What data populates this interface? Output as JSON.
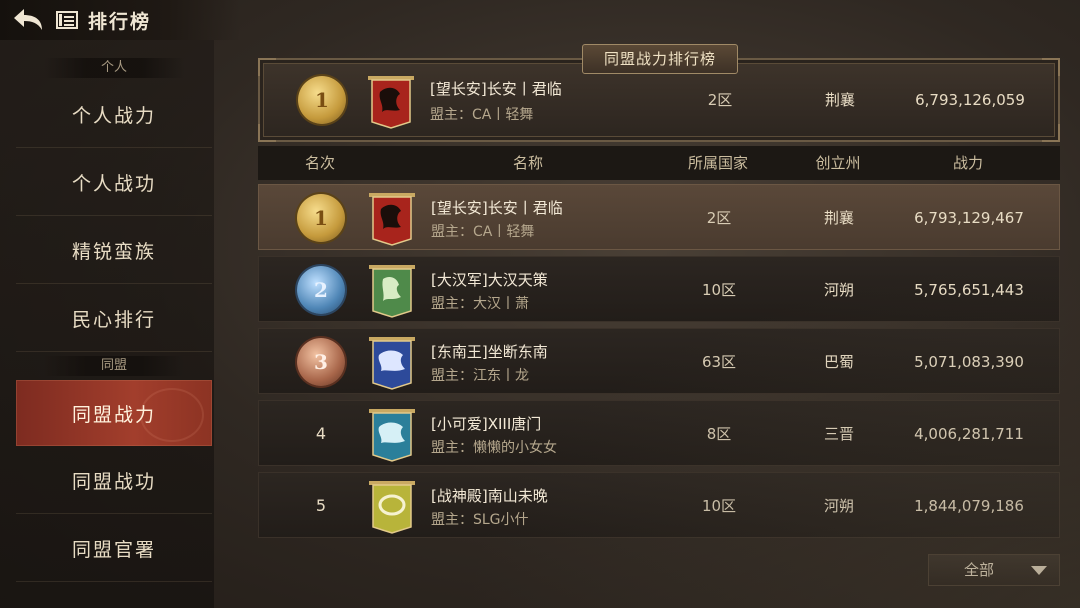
{
  "header": {
    "title": "排行榜"
  },
  "sidebar": {
    "section_personal": "个人",
    "section_alliance": "同盟",
    "items": [
      {
        "label": "个人战力"
      },
      {
        "label": "个人战功"
      },
      {
        "label": "精锐蛮族"
      },
      {
        "label": "民心排行"
      },
      {
        "label": "同盟战力"
      },
      {
        "label": "同盟战功"
      },
      {
        "label": "同盟官署"
      }
    ],
    "active_index": 4
  },
  "banner": {
    "title": "同盟战力排行榜",
    "rank": "1",
    "name": "[望长安]长安丨君临",
    "leader": "盟主：CA丨轻舞",
    "region": "2区",
    "state": "荆襄",
    "power": "6,793,126,059"
  },
  "table": {
    "headers": {
      "rank": "名次",
      "name": "名称",
      "country": "所属国家",
      "state": "创立州",
      "power": "战力"
    },
    "rows": [
      {
        "rank": "1",
        "name": "[望长安]长安丨君临",
        "leader": "盟主：CA丨轻舞",
        "region": "2区",
        "state": "荆襄",
        "power": "6,793,129,467",
        "flag_color": "#a8241c",
        "flag_emblem": "#1a0e0a",
        "medal": "gold"
      },
      {
        "rank": "2",
        "name": "[大汉军]大汉天策",
        "leader": "盟主：大汉丨萧",
        "region": "10区",
        "state": "河朔",
        "power": "5,765,651,443",
        "flag_color": "#4f8a4a",
        "flag_emblem": "#d8ecc4",
        "medal": "silver"
      },
      {
        "rank": "3",
        "name": "[东南王]坐断东南",
        "leader": "盟主：江东丨龙",
        "region": "63区",
        "state": "巴蜀",
        "power": "5,071,083,390",
        "flag_color": "#2d4a9a",
        "flag_emblem": "#dde6ff",
        "medal": "bronze"
      },
      {
        "rank": "4",
        "name": "[小可爱]XIII唐门",
        "leader": "盟主：懒懒的小女女",
        "region": "8区",
        "state": "三晋",
        "power": "4,006,281,711",
        "flag_color": "#2b7f9a",
        "flag_emblem": "#d6f0f6",
        "medal": ""
      },
      {
        "rank": "5",
        "name": "[战神殿]南山未晚",
        "leader": "盟主：SLG小什",
        "region": "10区",
        "state": "河朔",
        "power": "1,844,079,186",
        "flag_color": "#b8b43a",
        "flag_emblem": "#f6f2d0",
        "medal": ""
      }
    ]
  },
  "filter": {
    "label": "全部"
  }
}
